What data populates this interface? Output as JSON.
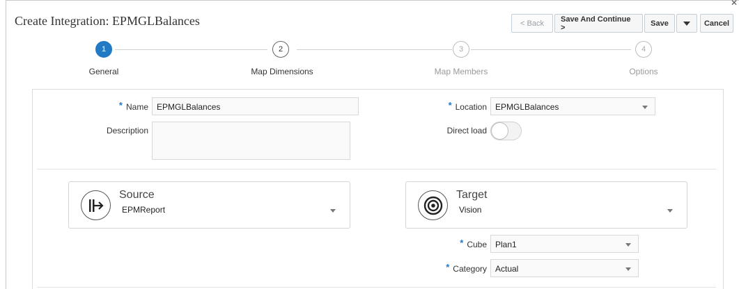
{
  "dialog": {
    "title": "Create Integration: EPMGLBalances",
    "close_icon": "close-icon"
  },
  "toolbar": {
    "back_label": "< Back",
    "save_continue_label": "Save And Continue >",
    "save_label": "Save",
    "cancel_label": "Cancel"
  },
  "train": {
    "steps": [
      {
        "number": "1",
        "label": "General",
        "state": "active"
      },
      {
        "number": "2",
        "label": "Map Dimensions",
        "state": "enabled"
      },
      {
        "number": "3",
        "label": "Map Members",
        "state": "disabled"
      },
      {
        "number": "4",
        "label": "Options",
        "state": "disabled"
      }
    ]
  },
  "form": {
    "name_label": "Name",
    "name_value": "EPMGLBalances",
    "description_label": "Description",
    "description_value": "",
    "location_label": "Location",
    "location_value": "EPMGLBalances",
    "direct_load_label": "Direct load",
    "direct_load_on": false,
    "required_marker": "*"
  },
  "source": {
    "title": "Source",
    "value": "EPMReport",
    "icon": "source-icon"
  },
  "target": {
    "title": "Target",
    "value": "Vision",
    "icon": "target-icon",
    "cube_label": "Cube",
    "cube_value": "Plan1",
    "category_label": "Category",
    "category_value": "Actual"
  },
  "colors": {
    "accent": "#227ac4",
    "border": "#d4d4d4"
  }
}
